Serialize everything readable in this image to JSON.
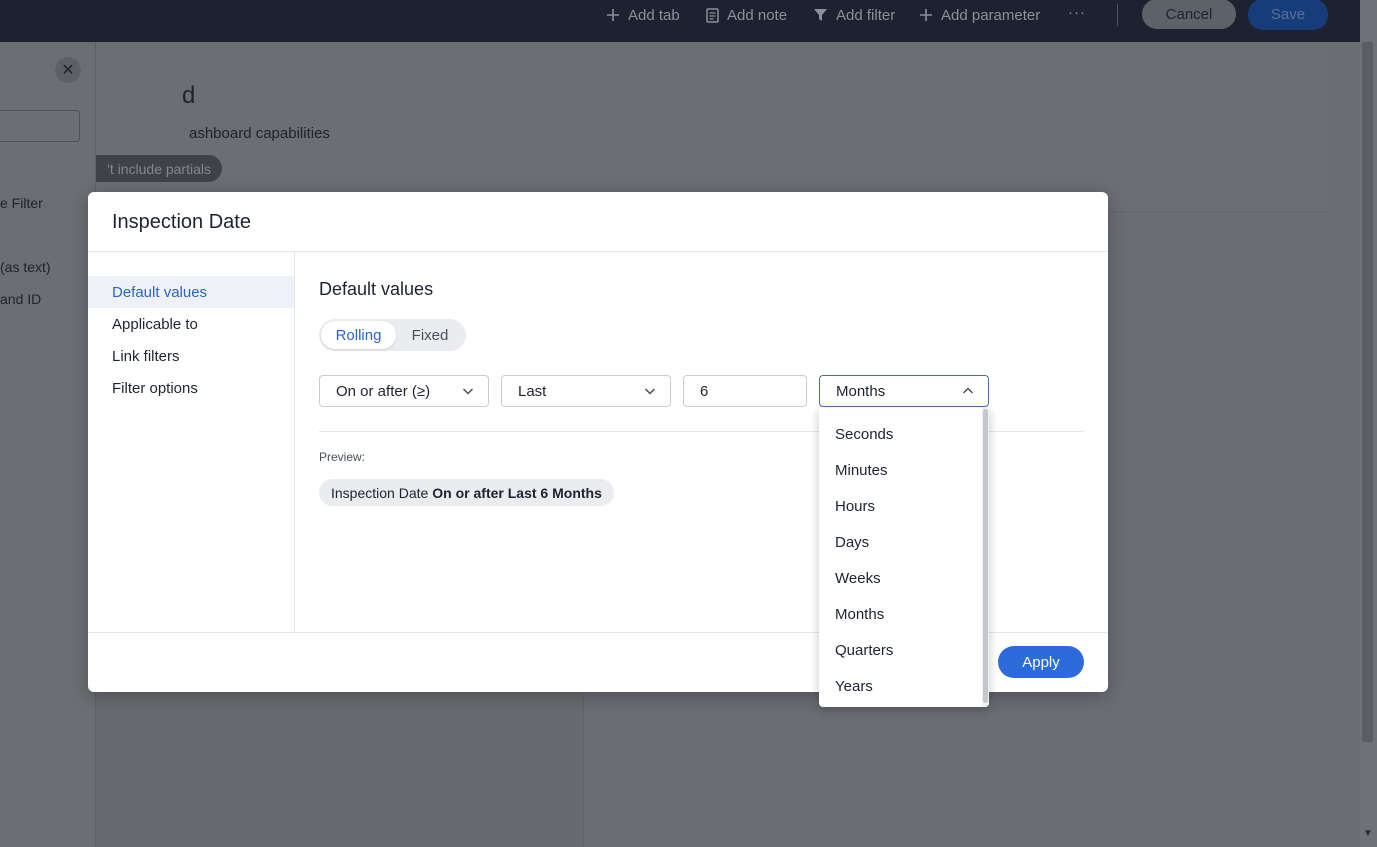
{
  "topbar": {
    "add_tab": "Add tab",
    "add_note": "Add note",
    "add_filter": "Add filter",
    "add_parameter": "Add parameter",
    "more": "···",
    "cancel": "Cancel",
    "save": "Save"
  },
  "background": {
    "title_fragment": "d",
    "subtitle_fragment": "ashboard capabilities",
    "pill_fragment": "'t include partials",
    "left_items": [
      "e Filter",
      "(as text)",
      "and ID"
    ]
  },
  "modal": {
    "title": "Inspection Date",
    "nav": [
      {
        "label": "Default values"
      },
      {
        "label": "Applicable to"
      },
      {
        "label": "Link filters"
      },
      {
        "label": "Filter options"
      }
    ],
    "content_title": "Default values",
    "mode": {
      "rolling": "Rolling",
      "fixed": "Fixed",
      "selected": "Rolling"
    },
    "operator": "On or after (≥)",
    "range": "Last",
    "amount": "6",
    "unit": "Months",
    "preview_label": "Preview:",
    "preview_field": "Inspection Date",
    "preview_condition": "On or after Last 6 Months",
    "apply": "Apply"
  },
  "unit_options": [
    "Seconds",
    "Minutes",
    "Hours",
    "Days",
    "Weeks",
    "Months",
    "Quarters",
    "Years"
  ],
  "colors": {
    "accent": "#2d6bdc",
    "active_nav_bg": "#eef1f7",
    "overlay": "#6a6d72"
  }
}
